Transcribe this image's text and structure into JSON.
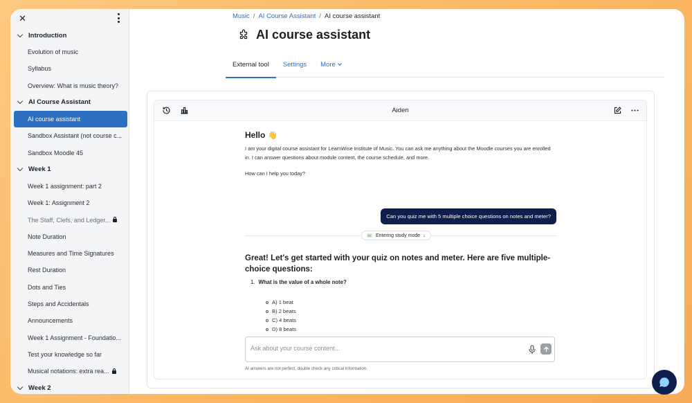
{
  "sidebar": {
    "sections": [
      {
        "label": "Introduction",
        "items": [
          {
            "label": "Evolution of music"
          },
          {
            "label": "Syllabus"
          },
          {
            "label": "Overview: What is music theory?"
          }
        ]
      },
      {
        "label": "AI Course Assistant",
        "items": [
          {
            "label": "AI course assistant"
          },
          {
            "label": "Sandbox Assistant (not course c..."
          },
          {
            "label": "Sandbox Moodle 45"
          }
        ]
      },
      {
        "label": "Week 1",
        "items": [
          {
            "label": "Week 1 assignment: part 2"
          },
          {
            "label": "Week 1: Assignment 2"
          },
          {
            "label": "The Staff, Clefs, and Ledger..."
          },
          {
            "label": "Note Duration"
          },
          {
            "label": "Measures and Time Signatures"
          },
          {
            "label": "Rest Duration"
          },
          {
            "label": "Dots and Ties"
          },
          {
            "label": "Steps and Accidentals"
          },
          {
            "label": "Announcements"
          },
          {
            "label": "Week 1 Assignment - Foundatio..."
          },
          {
            "label": "Test your knowledge so far"
          },
          {
            "label": "Musical notations: extra rea..."
          }
        ]
      },
      {
        "label": "Week 2"
      }
    ]
  },
  "breadcrumb": {
    "items": [
      "Music",
      "AI Course Assistant",
      "AI course assistant"
    ]
  },
  "page": {
    "title": "AI course assistant"
  },
  "tabs": [
    "External tool",
    "Settings",
    "More"
  ],
  "chat": {
    "assistant_name": "Aiden",
    "greeting": "Hello",
    "wave": "👋",
    "intro": "I am your digital course assistant for LearnWise Institute of Music. You can ask me anything about the Moodle courses you are enrolled in. I can answer questions about module content, the course schedule, and more.",
    "how_can": "How can I help you today?",
    "user_message": "Can you quiz me with 5 multiple choice questions on notes and meter?",
    "study_mode_label": "Entering study mode",
    "study_badge": "ST",
    "reply_title": "Great! Let's get started with your quiz on notes and meter. Here are five multiple-choice questions:",
    "question_number": "1.",
    "question": "What is the value of a whole note?",
    "options": [
      "A) 1 beat",
      "B) 2 beats",
      "C) 4 beats",
      "D) 8 beats"
    ],
    "placeholder": "Ask about your course content...",
    "disclaimer": "AI answers are not perfect, double check any critical information."
  },
  "colors": {
    "accent": "#2d6fc1",
    "navy": "#0f1f4d",
    "background": "#fbb865"
  }
}
